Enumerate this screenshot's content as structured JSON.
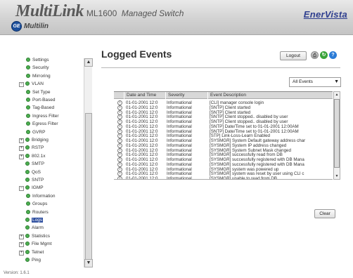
{
  "header": {
    "brand": "MultiLink",
    "model": "ML1600",
    "subtitle": "Managed Switch",
    "ge_logo": "GE",
    "company": "Multilin",
    "product_logo": "EnerVista"
  },
  "sidebar": {
    "items": [
      {
        "label": "Settings",
        "level": 1,
        "toggle": "",
        "icon": "leaf-icon"
      },
      {
        "label": "Security",
        "level": 1,
        "toggle": "",
        "icon": "leaf-icon"
      },
      {
        "label": "Mirroring",
        "level": 1,
        "toggle": "",
        "icon": "leaf-icon"
      },
      {
        "label": "VLAN",
        "level": 0,
        "toggle": "−",
        "icon": "folder-icon"
      },
      {
        "label": "Set Type",
        "level": 1,
        "toggle": "",
        "icon": "leaf-icon"
      },
      {
        "label": "Port-Based",
        "level": 1,
        "toggle": "",
        "icon": "leaf-icon"
      },
      {
        "label": "Tag-Based",
        "level": 1,
        "toggle": "",
        "icon": "leaf-icon"
      },
      {
        "label": "Ingress Filter",
        "level": 1,
        "toggle": "",
        "icon": "leaf-icon"
      },
      {
        "label": "Egress Filter",
        "level": 1,
        "toggle": "",
        "icon": "leaf-icon"
      },
      {
        "label": "GVRP",
        "level": 1,
        "toggle": "",
        "icon": "leaf-icon"
      },
      {
        "label": "Bridging",
        "level": 0,
        "toggle": "+",
        "icon": "folder-icon"
      },
      {
        "label": "RSTP",
        "level": 0,
        "toggle": "+",
        "icon": "folder-icon"
      },
      {
        "label": "802.1x",
        "level": 0,
        "toggle": "+",
        "icon": "folder-icon"
      },
      {
        "label": "SMTP",
        "level": 0,
        "toggle": "",
        "icon": "leaf-icon"
      },
      {
        "label": "QoS",
        "level": 0,
        "toggle": "",
        "icon": "leaf-icon"
      },
      {
        "label": "SNTP",
        "level": 0,
        "toggle": "",
        "icon": "leaf-icon"
      },
      {
        "label": "IGMP",
        "level": 0,
        "toggle": "−",
        "icon": "folder-icon"
      },
      {
        "label": "Information",
        "level": 1,
        "toggle": "",
        "icon": "leaf-icon"
      },
      {
        "label": "Groups",
        "level": 1,
        "toggle": "",
        "icon": "leaf-icon"
      },
      {
        "label": "Routers",
        "level": 1,
        "toggle": "",
        "icon": "leaf-icon"
      },
      {
        "label": "Logs",
        "level": 0,
        "toggle": "",
        "icon": "leaf-icon",
        "selected": true
      },
      {
        "label": "Alarm",
        "level": 0,
        "toggle": "",
        "icon": "leaf-icon"
      },
      {
        "label": "Statistics",
        "level": 0,
        "toggle": "+",
        "icon": "folder-icon"
      },
      {
        "label": "File Mgmt",
        "level": 0,
        "toggle": "+",
        "icon": "folder-icon"
      },
      {
        "label": "Telnet",
        "level": 0,
        "toggle": "+",
        "icon": "folder-icon"
      },
      {
        "label": "Ping",
        "level": 0,
        "toggle": "",
        "icon": "leaf-icon"
      }
    ]
  },
  "version": "Version: 1.6.1",
  "main": {
    "title": "Logged Events",
    "logout_label": "Logout",
    "filter_value": "All Events",
    "clear_label": "Clear",
    "columns": [
      "Date and Time",
      "Severity",
      "Event Description"
    ],
    "rows": [
      {
        "date": "01-01-2001 12:0",
        "severity": "Informational",
        "desc": "[CLI] manager console login"
      },
      {
        "date": "01-01-2001 12:0",
        "severity": "Informational",
        "desc": "[SNTP] Client started"
      },
      {
        "date": "01-01-2001 12:0",
        "severity": "Informational",
        "desc": "[SNTP] Client started"
      },
      {
        "date": "01-01-2001 12:0",
        "severity": "Informational",
        "desc": "[SNTP] Client stopped.. disabled by user"
      },
      {
        "date": "01-01-2001 12:0",
        "severity": "Informational",
        "desc": "[SNTP] Client stopped.. disabled by user"
      },
      {
        "date": "01-01-2001 12:0",
        "severity": "Informational",
        "desc": "[SNTP] Date/Time set to 01-01-2001 12:00AM"
      },
      {
        "date": "01-01-2001 12:0",
        "severity": "Informational",
        "desc": "[SNTP] Date/Time set to 01-01-2001 12:00AM"
      },
      {
        "date": "01-01-2001 12:0",
        "severity": "Informational",
        "desc": "[STP] Link-Loss-Learn Enabled"
      },
      {
        "date": "01-01-2001 12:0",
        "severity": "Informational",
        "desc": "[SYSMGR] System Default gateway address char"
      },
      {
        "date": "01-01-2001 12:0",
        "severity": "Informational",
        "desc": "[SYSMGR] System IP address changed"
      },
      {
        "date": "01-01-2001 12:0",
        "severity": "Informational",
        "desc": "[SYSMGR] System Subnet Mask changed"
      },
      {
        "date": "01-01-2001 12:0",
        "severity": "Informational",
        "desc": "[SYSMGR] successfully read from DB"
      },
      {
        "date": "01-01-2001 12:0",
        "severity": "Informational",
        "desc": "[SYSMGR] successfully registered with DB Mana"
      },
      {
        "date": "01-01-2001 12:0",
        "severity": "Informational",
        "desc": "[SYSMGR] successfully registered with DB Mana"
      },
      {
        "date": "01-01-2001 12:0",
        "severity": "Informational",
        "desc": "[SYSMGR] system was powered up"
      },
      {
        "date": "01-01-2001 12:0",
        "severity": "Informational",
        "desc": "[SYSMGR] system was reset by user using CLI c"
      },
      {
        "date": "01-01-2001 12:0",
        "severity": "Informational",
        "desc": "[SYSMGR] unable to read from DB"
      }
    ]
  },
  "colors": {
    "tree_icon": "#4caf50",
    "selected_bg": "#2e4f9f",
    "accent": "#2f3f8f"
  }
}
